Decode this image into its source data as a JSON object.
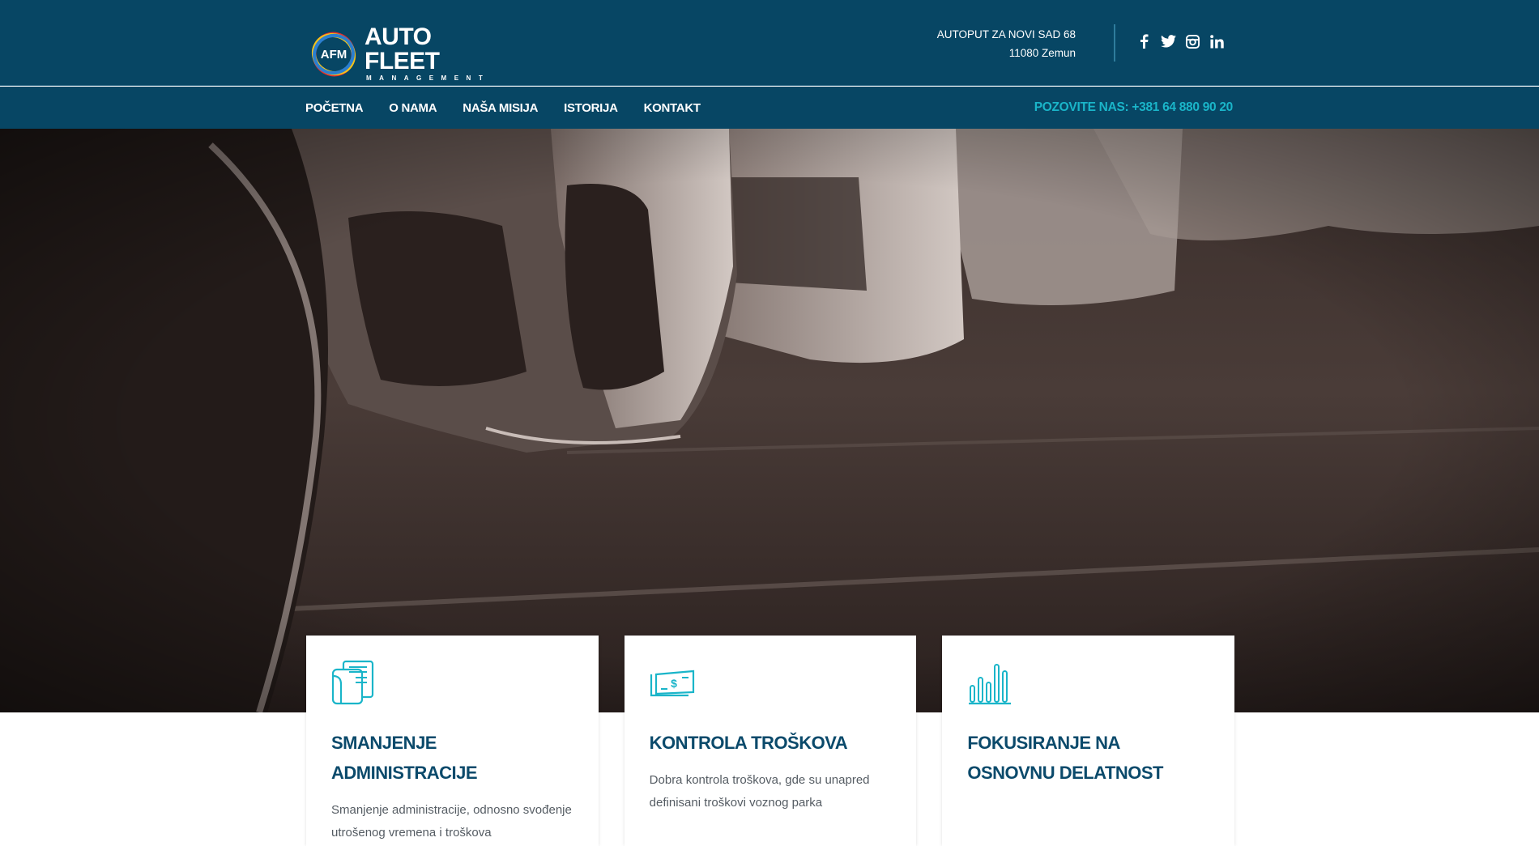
{
  "logo": {
    "mark_text": "AFM",
    "main": "AUTO FLEET",
    "sub": "MANAGEMENT"
  },
  "address": {
    "line1": "AUTOPUT ZA NOVI SAD 68",
    "line2": "11080 Zemun"
  },
  "social": [
    "facebook-icon",
    "twitter-icon",
    "instagram-icon",
    "linkedin-icon"
  ],
  "nav": {
    "items": [
      "POČETNA",
      "O NAMA",
      "NAŠA MISIJA",
      "ISTORIJA",
      "KONTAKT"
    ]
  },
  "call": "POZOVITE NAS: +381 64 880 90 20",
  "colors": {
    "header_bg": "#074664",
    "accent": "#1ab5c9",
    "title": "#0b4a6b"
  },
  "cards": [
    {
      "icon": "documents-icon",
      "title": "SMANJENJE ADMINISTRACIJE",
      "text": "Smanjenje administracije, odnosno svođenje utrošenog vremena i troškova"
    },
    {
      "icon": "money-bill-icon",
      "title": "KONTROLA TROŠKOVA",
      "text": "Dobra kontrola troškova, gde su unapred definisani troškovi voznog parka"
    },
    {
      "icon": "bar-chart-icon",
      "title": "FOKUSIRANJE NA OSNOVNU DELATNOST",
      "text": ""
    }
  ]
}
